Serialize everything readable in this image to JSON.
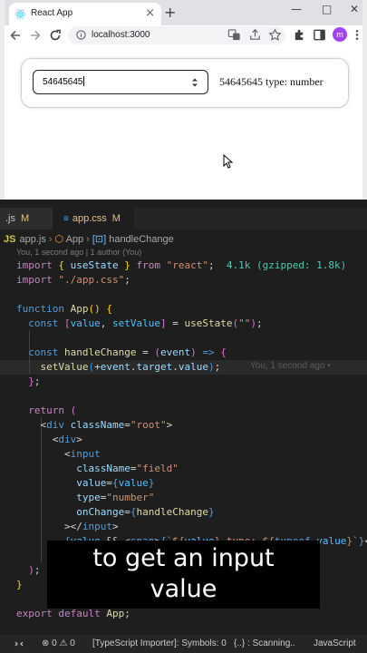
{
  "browser": {
    "tab_title": "React App",
    "tab_close": "×",
    "new_tab": "+",
    "url": "localhost:3000",
    "profile_initial": "m",
    "window_controls": {
      "minimize": "—",
      "maximize": "□",
      "close": "✕"
    }
  },
  "app": {
    "input_value": "54645645",
    "output_text": "54645645 type: number"
  },
  "editor": {
    "tabs": [
      {
        "label": ".js",
        "status": "M"
      },
      {
        "label": "app.css",
        "status": "M"
      }
    ],
    "breadcrumb": {
      "file": "app.js",
      "component": "App",
      "handler": "handleChange"
    },
    "blame_header": "You, 1 second ago | 1 author (You)",
    "import_size": "4.1k (gzipped: 1.8k)",
    "inline_blame": "You, 1 second ago •"
  },
  "caption": {
    "line1": "to get an input",
    "line2": "value"
  },
  "statusbar": {
    "problems_errors": "0",
    "problems_warnings": "0",
    "ts_importer": "[TypeScript Importer]: Symbols: 0",
    "scanning": "{..} : Scanning..",
    "language": "JavaScript"
  },
  "colors": {
    "editor_bg": "#1e1e1e",
    "keyword": "#c586c0",
    "string": "#ce9178",
    "function": "#dcdcaa",
    "variable": "#9cdcfe"
  }
}
